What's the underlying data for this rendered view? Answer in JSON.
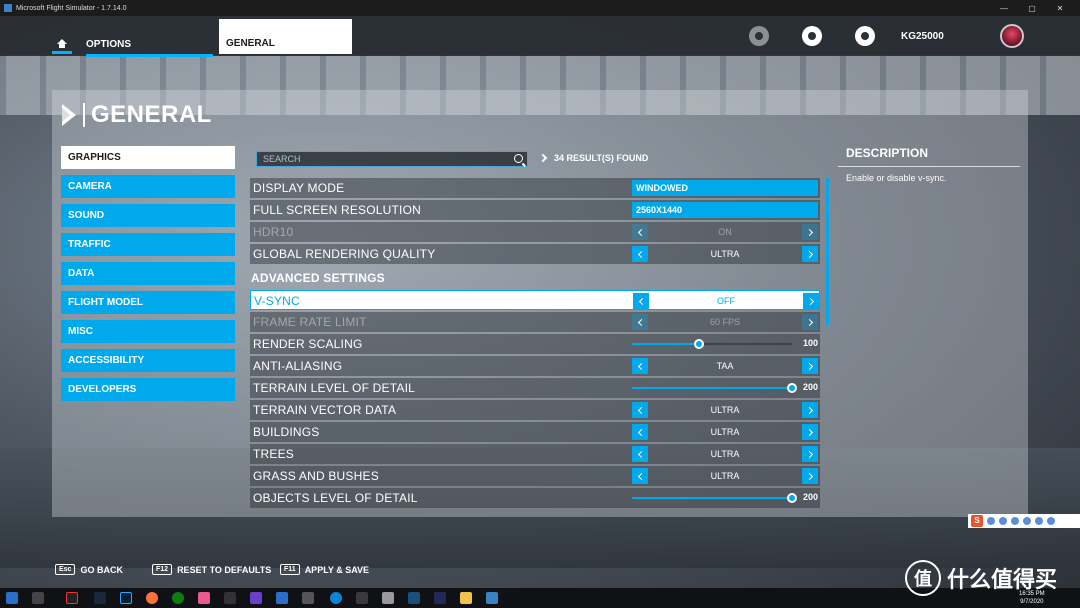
{
  "window": {
    "title": "Microsoft Flight Simulator - 1.7.14.0"
  },
  "topnav": {
    "options_label": "OPTIONS",
    "general_tab_label": "GENERAL",
    "username": "KG25000"
  },
  "panel": {
    "title": "GENERAL"
  },
  "categories": [
    {
      "label": "GRAPHICS",
      "active": true
    },
    {
      "label": "CAMERA"
    },
    {
      "label": "SOUND"
    },
    {
      "label": "TRAFFIC"
    },
    {
      "label": "DATA"
    },
    {
      "label": "FLIGHT MODEL"
    },
    {
      "label": "MISC"
    },
    {
      "label": "ACCESSIBILITY"
    },
    {
      "label": "DEVELOPERS"
    }
  ],
  "search": {
    "placeholder": "SEARCH",
    "results": "34 RESULT(S) FOUND"
  },
  "settings": {
    "display_mode": {
      "label": "DISPLAY MODE",
      "value": "WINDOWED"
    },
    "resolution": {
      "label": "FULL SCREEN RESOLUTION",
      "value": "2560X1440"
    },
    "hdr10": {
      "label": "HDR10",
      "value": "ON"
    },
    "global_quality": {
      "label": "GLOBAL RENDERING QUALITY",
      "value": "ULTRA"
    },
    "advanced_header": "ADVANCED SETTINGS",
    "vsync": {
      "label": "V-SYNC",
      "value": "OFF"
    },
    "frame_rate_limit": {
      "label": "FRAME RATE LIMIT",
      "value": "60 FPS"
    },
    "render_scaling": {
      "label": "RENDER SCALING",
      "value": "100",
      "fraction": 0.42
    },
    "anti_aliasing": {
      "label": "ANTI-ALIASING",
      "value": "TAA"
    },
    "terrain_lod": {
      "label": "TERRAIN LEVEL OF DETAIL",
      "value": "200",
      "fraction": 1.0
    },
    "terrain_vector": {
      "label": "TERRAIN VECTOR DATA",
      "value": "ULTRA"
    },
    "buildings": {
      "label": "BUILDINGS",
      "value": "ULTRA"
    },
    "trees": {
      "label": "TREES",
      "value": "ULTRA"
    },
    "grass": {
      "label": "GRASS AND BUSHES",
      "value": "ULTRA"
    },
    "objects_lod": {
      "label": "OBJECTS LEVEL OF DETAIL",
      "value": "200",
      "fraction": 1.0
    }
  },
  "description": {
    "title": "DESCRIPTION",
    "text": "Enable or disable v-sync."
  },
  "bottom": {
    "back_key": "Esc",
    "back_label": "GO BACK",
    "reset_key": "F12",
    "reset_label": "RESET TO DEFAULTS",
    "apply_key": "F11",
    "apply_label": "APPLY & SAVE"
  },
  "watermark": {
    "logo": "值",
    "text": "什么值得买"
  },
  "clock": {
    "time": "16:35 PM",
    "date": "9/7/2020"
  },
  "colors": {
    "accent": "#00a9ec",
    "panel": "#d6dadf"
  }
}
